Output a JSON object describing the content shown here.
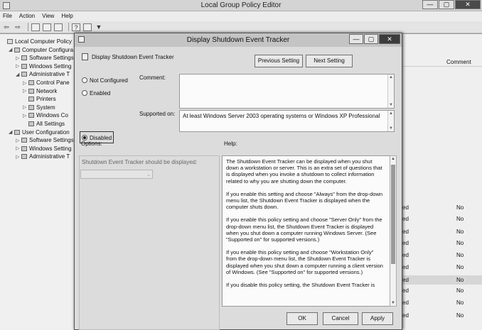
{
  "app": {
    "title": "Local Group Policy Editor",
    "window_buttons": {
      "minimize": "—",
      "maximize": "▢",
      "close": "✕"
    }
  },
  "menu": [
    "File",
    "Action",
    "View",
    "Help"
  ],
  "toolbar_icons": [
    "back-icon",
    "forward-icon",
    "up-folder-icon",
    "show-hide-tree-icon",
    "export-list-icon",
    "help-icon",
    "properties-icon",
    "filter-icon"
  ],
  "tree": [
    {
      "label": "Local Computer Policy",
      "indent": 0,
      "caret": ""
    },
    {
      "label": "Computer Configura",
      "indent": 1,
      "caret": "◢"
    },
    {
      "label": "Software Settings",
      "indent": 2,
      "caret": "▷"
    },
    {
      "label": "Windows Setting",
      "indent": 2,
      "caret": "▷"
    },
    {
      "label": "Administrative T",
      "indent": 2,
      "caret": "◢"
    },
    {
      "label": "Control Pane",
      "indent": 3,
      "caret": "▷"
    },
    {
      "label": "Network",
      "indent": 3,
      "caret": "▷"
    },
    {
      "label": "Printers",
      "indent": 3,
      "caret": ""
    },
    {
      "label": "System",
      "indent": 3,
      "caret": "▷"
    },
    {
      "label": "Windows Co",
      "indent": 3,
      "caret": "▷"
    },
    {
      "label": "All Settings",
      "indent": 3,
      "caret": ""
    },
    {
      "label": "User Configuration",
      "indent": 1,
      "caret": "◢"
    },
    {
      "label": "Software Settings",
      "indent": 2,
      "caret": "▷"
    },
    {
      "label": "Windows Setting",
      "indent": 2,
      "caret": "▷"
    },
    {
      "label": "Administrative T",
      "indent": 2,
      "caret": "▷"
    }
  ],
  "right_pane": {
    "column_header": "Comment",
    "rows": [
      {
        "c1": "ed",
        "c2": "No"
      },
      {
        "c1": "ed",
        "c2": "No"
      },
      {
        "c1": "ed",
        "c2": "No"
      },
      {
        "c1": "ed",
        "c2": "No"
      },
      {
        "c1": "ed",
        "c2": "No"
      },
      {
        "c1": "ed",
        "c2": "No"
      },
      {
        "c1": "ed",
        "c2": "No"
      },
      {
        "c1": "ed",
        "c2": "No"
      },
      {
        "c1": "ed",
        "c2": "No"
      },
      {
        "c1": "ed",
        "c2": "No"
      }
    ]
  },
  "dialog": {
    "title": "Display Shutdown Event Tracker",
    "policy_name": "Display Shutdown Event Tracker",
    "previous_setting": "Previous Setting",
    "next_setting": "Next Setting",
    "radio_not_configured": "Not Configured",
    "radio_enabled": "Enabled",
    "radio_disabled": "Disabled",
    "selected_option": "Disabled",
    "comment_label": "Comment:",
    "comment_value": "",
    "supported_on_label": "Supported on:",
    "supported_on_value": "At least Windows Server 2003 operating systems or Windows XP Professional",
    "options_label": "Options:",
    "help_label": "Help:",
    "option_field_label": "Shutdown Event Tracker should be displayed:",
    "option_select_value": "",
    "help_paragraphs": [
      "The Shutdown Event Tracker can be displayed when you shut down a workstation or server.  This is an extra set of questions that is displayed when you invoke a shutdown to collect information related to why you are shutting down the computer.",
      "If you enable this setting and choose \"Always\" from the drop-down menu list, the Shutdown Event Tracker is displayed when the computer shuts down.",
      "If you enable this policy setting and choose \"Server Only\" from the drop-down menu list, the Shutdown Event Tracker is displayed when you shut down a computer running Windows Server. (See \"Supported on\" for supported versions.)",
      "If you enable this policy setting and choose \"Workstation Only\" from the drop-down menu list, the Shutdown Event Tracker is displayed when you shut down a computer running a client version of Windows. (See \"Supported on\" for supported versions.)",
      "If you disable this policy setting, the Shutdown Event Tracker is"
    ],
    "ok": "OK",
    "cancel": "Cancel",
    "apply": "Apply"
  }
}
